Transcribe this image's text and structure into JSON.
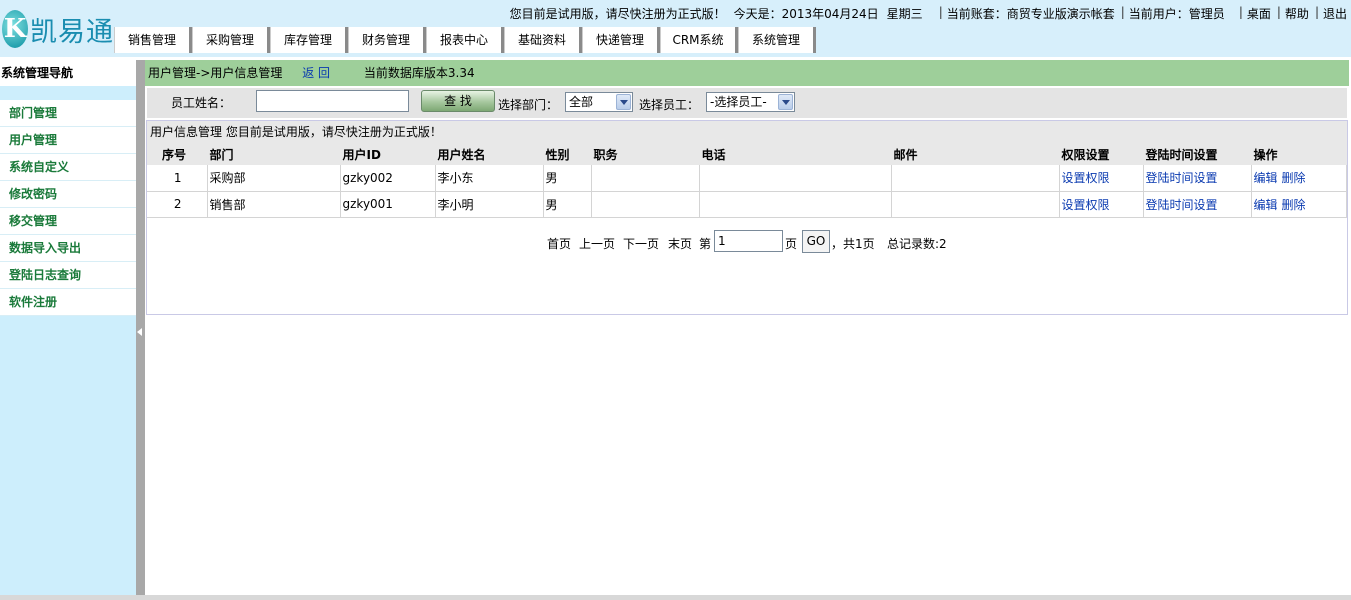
{
  "header": {
    "logo_text": "凯易通",
    "notice": "您目前是试用版，请尽快注册为正式版！",
    "today_label": "今天是：2013年04月24日",
    "weekday": "星期三",
    "account": "当前账套：商贸专业版演示帐套",
    "user": "当前用户：管理员",
    "links": [
      "桌面",
      "帮助",
      "退出"
    ]
  },
  "nav": {
    "tabs": [
      "销售管理",
      "采购管理",
      "库存管理",
      "财务管理",
      "报表中心",
      "基础资料",
      "快递管理",
      "CRM系统",
      "系统管理"
    ]
  },
  "sidebar": {
    "title": "系统管理导航",
    "items": [
      "部门管理",
      "用户管理",
      "系统自定义",
      "修改密码",
      "移交管理",
      "数据导入导出",
      "登陆日志查询",
      "软件注册"
    ]
  },
  "crumb": {
    "path": "用户管理->用户信息管理",
    "back": "返 回",
    "db_version": "当前数据库版本3.34"
  },
  "search": {
    "name_label": "员工姓名：",
    "name_value": "",
    "find_button": "查 找",
    "dept_label": "选择部门：",
    "dept_value": "全部",
    "emp_label": "选择员工：",
    "emp_value": "-选择员工-"
  },
  "table": {
    "title": "用户信息管理   您目前是试用版，请尽快注册为正式版！",
    "columns": [
      "序号",
      "部门",
      "用户ID",
      "用户姓名",
      "性别",
      "职务",
      "电话",
      "邮件",
      "权限设置",
      "登陆时间设置",
      "操作"
    ],
    "rows": [
      {
        "no": "1",
        "dept": "采购部",
        "uid": "gzky002",
        "name": "李小东",
        "sex": "男",
        "post": "",
        "phone": "",
        "email": "",
        "perm": "设置权限",
        "time": "登陆时间设置",
        "edit": "编辑",
        "del": "删除"
      },
      {
        "no": "2",
        "dept": "销售部",
        "uid": "gzky001",
        "name": "李小明",
        "sex": "男",
        "post": "",
        "phone": "",
        "email": "",
        "perm": "设置权限",
        "time": "登陆时间设置",
        "edit": "编辑",
        "del": "删除"
      }
    ]
  },
  "pager": {
    "first": "首页",
    "prev": "上一页",
    "next": "下一页",
    "last": "末页",
    "page_prefix": "第",
    "page_value": "1",
    "page_suffix": "页",
    "go": "GO",
    "total_pages": "，共1页",
    "total_records": "总记录数:2"
  }
}
